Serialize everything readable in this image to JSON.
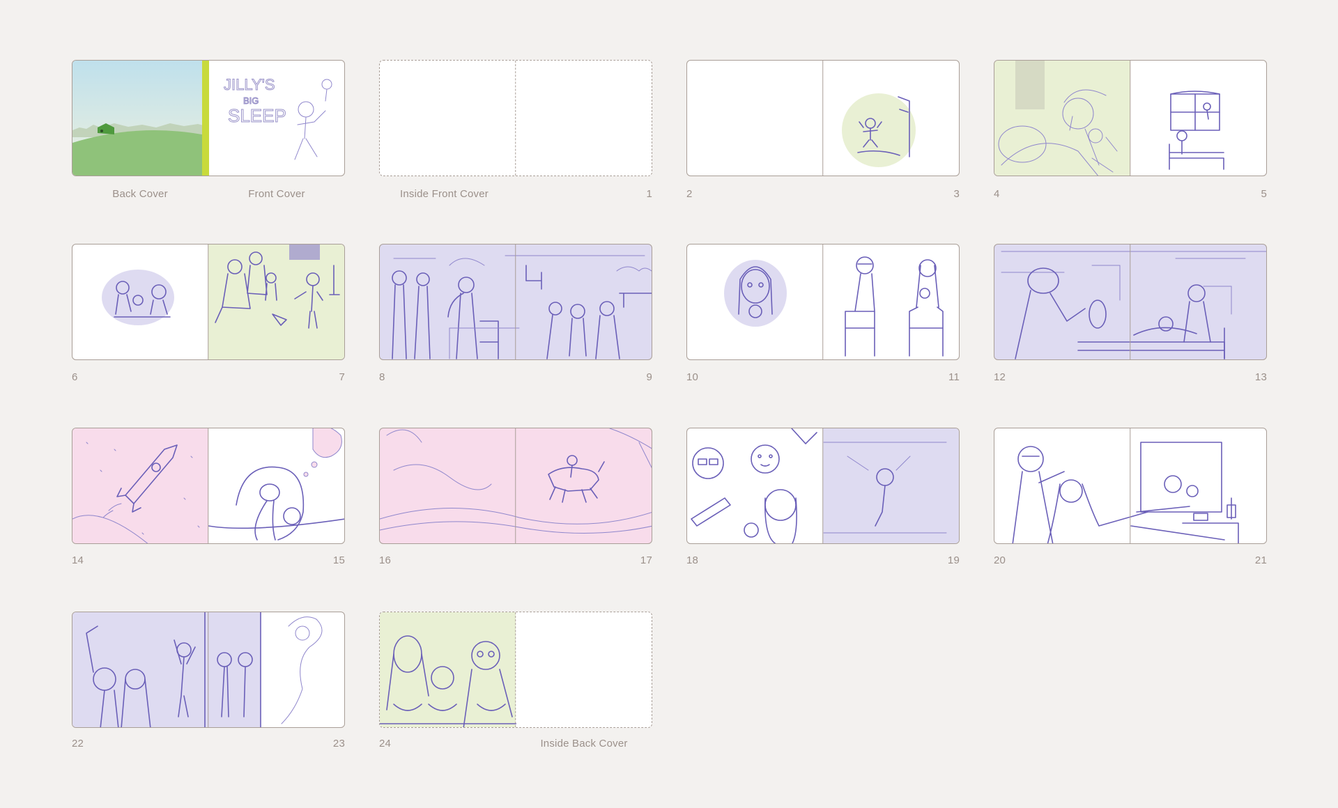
{
  "colors": {
    "background": "#f3f1ef",
    "border": "#a99e97",
    "label": "#9b908a",
    "sketch": "#6a5fb8",
    "lavender": "#dedbf1",
    "green": "#e9f0d4",
    "pink": "#f8dceb",
    "lime_spine": "#c8da3c",
    "sky": "#cfe6ea",
    "grass": "#8fc27a"
  },
  "labels": {
    "back_cover": "Back Cover",
    "front_cover": "Front Cover",
    "inside_front_cover": "Inside Front Cover",
    "inside_back_cover": "Inside Back Cover",
    "p1": "1",
    "p2": "2",
    "p3": "3",
    "p4": "4",
    "p5": "5",
    "p6": "6",
    "p7": "7",
    "p8": "8",
    "p9": "9",
    "p10": "10",
    "p11": "11",
    "p12": "12",
    "p13": "13",
    "p14": "14",
    "p15": "15",
    "p16": "16",
    "p17": "17",
    "p18": "18",
    "p19": "19",
    "p20": "20",
    "p21": "21",
    "p22": "22",
    "p23": "23",
    "p24": "24"
  },
  "cover": {
    "title_line1": "JILLY'S",
    "title_line2": "BIG",
    "title_line3": "SLEEP"
  }
}
